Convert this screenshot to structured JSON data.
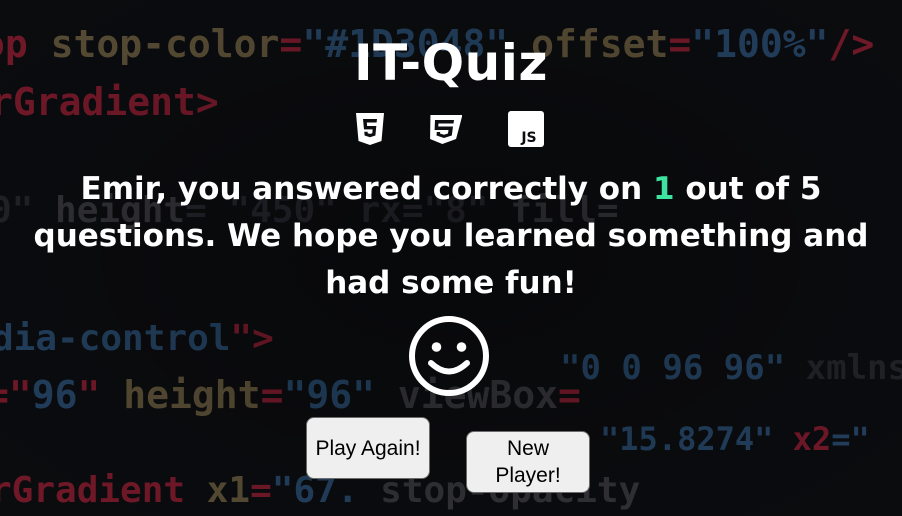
{
  "app": {
    "title": "IT-Quiz"
  },
  "tech_icons": [
    {
      "name": "html5-icon",
      "label": "HTML5"
    },
    {
      "name": "css3-icon",
      "label": "CSS3"
    },
    {
      "name": "javascript-icon",
      "label": "JS"
    }
  ],
  "result": {
    "player_name": "Emir",
    "text_before_score": "Emir, you answered correctly on ",
    "score": "1",
    "text_after_score": " out of 5 questions. We hope you learned something and had some fun!"
  },
  "face_icon": "smiley-face-icon",
  "buttons": {
    "play_again": "Play Again!",
    "new_player_line1": "New",
    "new_player_line2": "Player!"
  },
  "colors": {
    "score_accent": "#3ee3a2",
    "button_bg": "#efefef",
    "background": "#0c0d10"
  }
}
